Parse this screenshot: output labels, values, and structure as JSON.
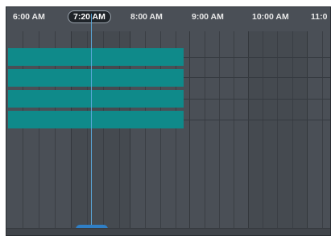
{
  "timeline": {
    "hour_labels": [
      "6:00 AM",
      "8:00 AM",
      "9:00 AM",
      "10:00 AM",
      "11:0"
    ],
    "current_time_label": "7:20 AM",
    "row_count": 4
  },
  "colors": {
    "background": "#4a4f56",
    "event_bar": "#0f8a8a",
    "current_time_line": "#5aa6d8",
    "scroll_thumb": "#2f7fc6"
  }
}
